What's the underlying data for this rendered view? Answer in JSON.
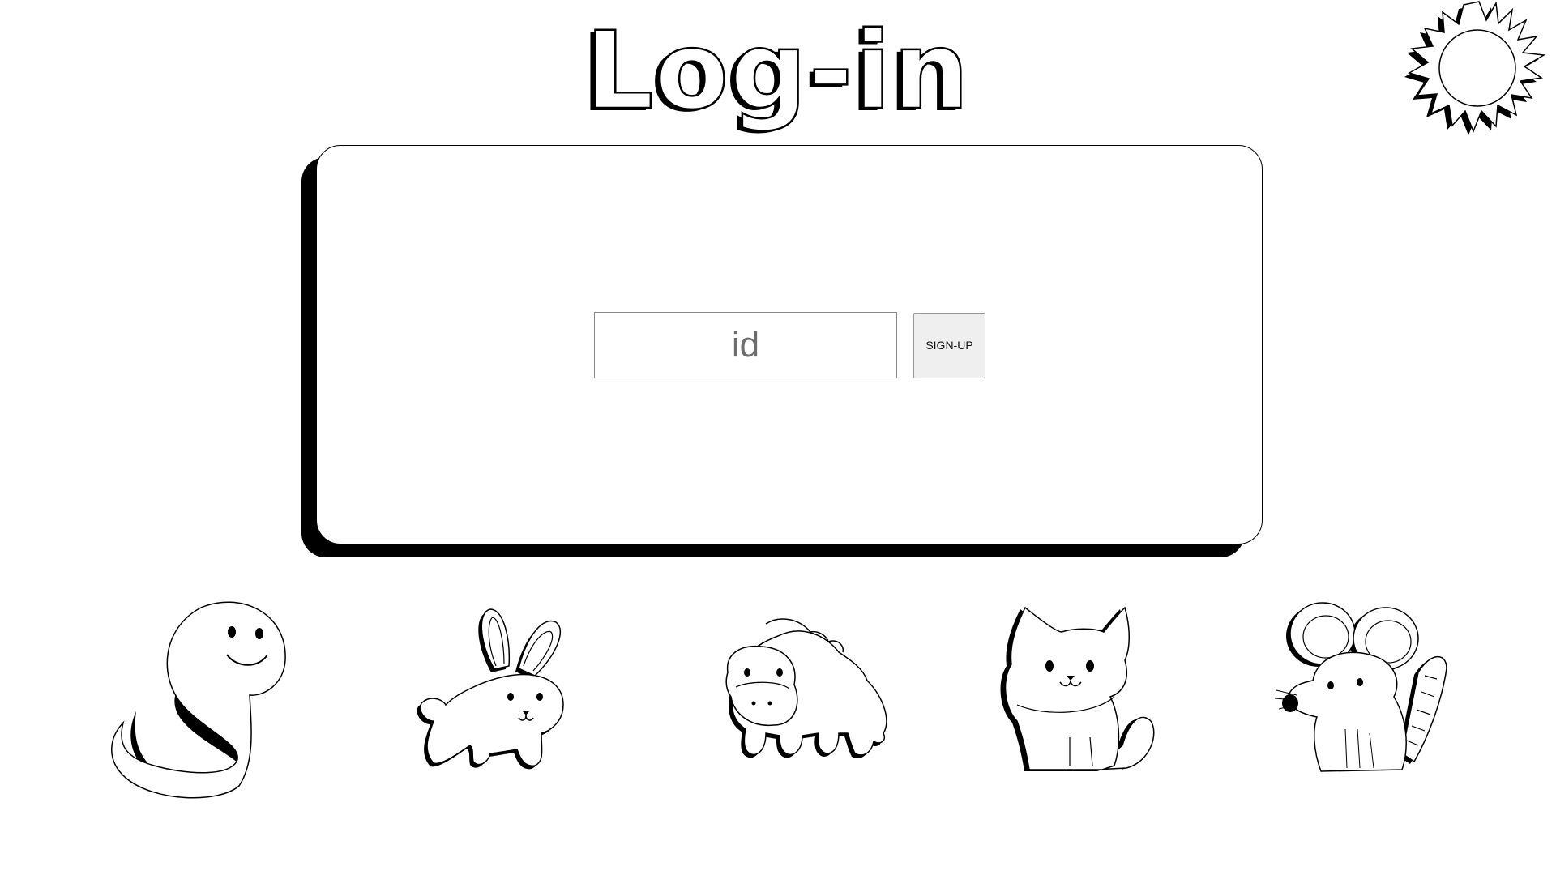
{
  "header": {
    "title": "Log-in"
  },
  "login": {
    "id_placeholder": "id",
    "id_value": "",
    "signup_label": "SIGN-UP"
  },
  "decor": {
    "sun_icon": "sun-icon",
    "animals": [
      "snake-icon",
      "rabbit-icon",
      "horse-icon",
      "cat-icon",
      "mouse-icon"
    ]
  },
  "colors": {
    "ink": "#000000",
    "background": "#ffffff",
    "button_bg": "#efefef"
  }
}
